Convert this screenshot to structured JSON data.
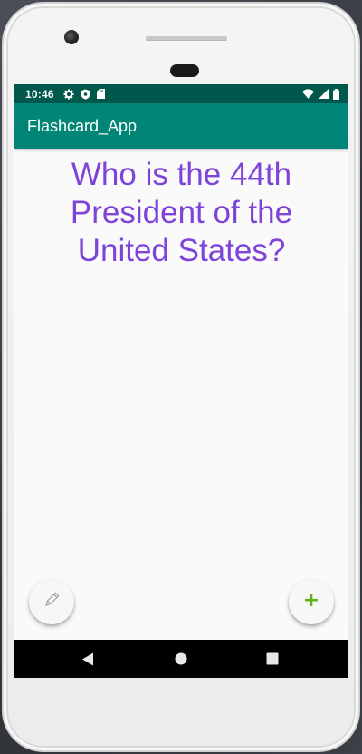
{
  "status_bar": {
    "time": "10:46",
    "left_icons": [
      "settings-gear-icon",
      "shield-icon",
      "sd-card-icon"
    ],
    "right_icons": [
      "wifi-icon",
      "cell-signal-icon",
      "battery-icon"
    ],
    "background": "#00574b"
  },
  "app_bar": {
    "title": "Flashcard_App",
    "background": "#008577"
  },
  "card": {
    "question": "Who is the 44th President of the United States?",
    "text_color": "#7e44da"
  },
  "actions": {
    "edit_icon": "pencil-icon",
    "add_icon": "plus-icon",
    "add_label": "+",
    "add_color": "#5fb314"
  },
  "navigation": {
    "icons": [
      "back-triangle-icon",
      "home-circle-icon",
      "recents-square-icon"
    ]
  }
}
